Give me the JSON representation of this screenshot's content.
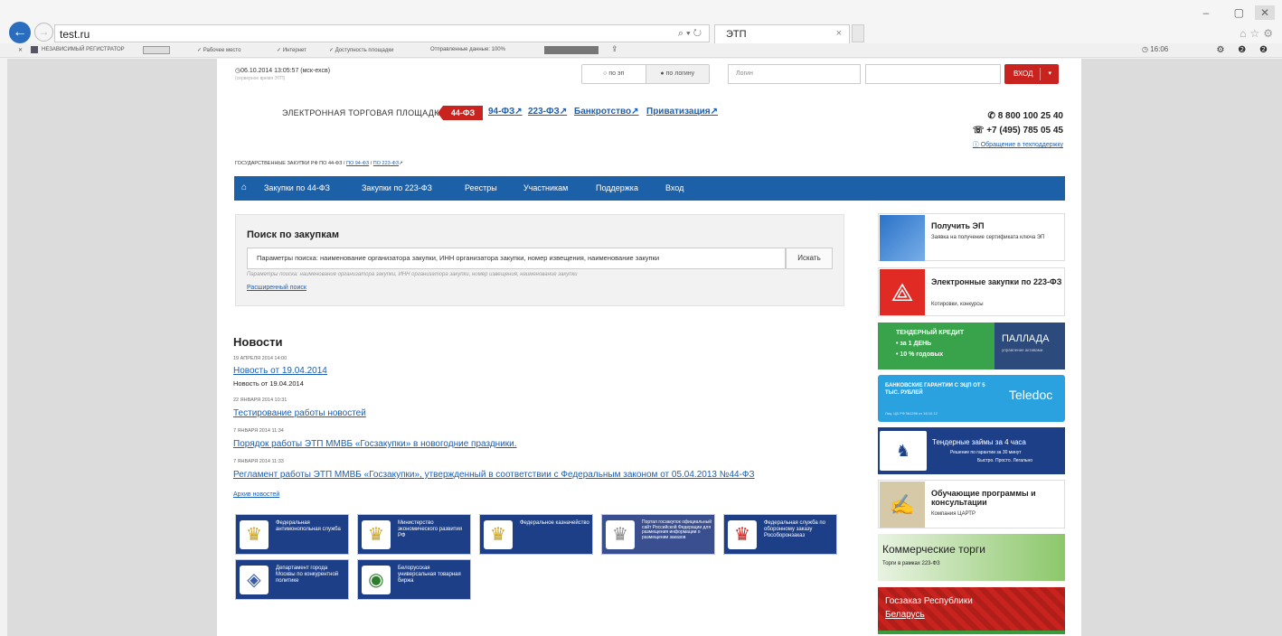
{
  "browser": {
    "url": "test.ru",
    "url_tools": "⌕ ▾ ↻",
    "tab_title": "ЭТП",
    "tab_close": "×",
    "win_controls": "– ▢",
    "win_close": "✕",
    "right_icons": "⌂☆⚙"
  },
  "toolbar": {
    "icon_x": "✕",
    "registrar": "НЕЗАВИСИМЫЙ РЕГИСТРАТОР",
    "workspace": "✓ Рабочее место",
    "internet": "✓ Интернет",
    "availability": "✓ Доступность площадки",
    "sent_data": "Отправленные данные: 100%",
    "clock": "16:06",
    "right_icons": "⚙ ❷ ❷"
  },
  "header": {
    "datetime": "06.10.2014 13:05:57 (мск-ехсв)",
    "server_note": "(серверное время ЭТП)",
    "mode_options": [
      "по эп",
      "по логину"
    ],
    "login_placeholder": "Логин",
    "password_placeholder": "",
    "login_button": "ВХОД",
    "login_caret": "▾"
  },
  "brand": {
    "title": "ЭЛЕКТРОННАЯ ТОРГОВАЯ ПЛОЩАДКА",
    "badge": "44-ФЗ",
    "links": [
      "94-ФЗ",
      "223-ФЗ",
      "Банкротство",
      "Приватизация"
    ],
    "phone1": "8 800 100 25 40",
    "phone2": "+7 (495) 785 05 45",
    "support": "Обращение в техподдержку",
    "gov_prefix": "ГОСУДАРСТВЕННЫЕ ЗАКУПКИ РФ ПО 44-ФЗ /",
    "gov_link1": "ПО 94-ФЗ",
    "gov_link2": "ПО 223-ФЗ"
  },
  "nav": {
    "home_icon": "⌂",
    "items": [
      "Закупки по 44-ФЗ",
      "Закупки по 223-ФЗ",
      "Реестры",
      "Участникам",
      "Поддержка",
      "Вход"
    ]
  },
  "search": {
    "title": "Поиск по закупкам",
    "placeholder": "Параметры поиска: наименование организатора закупки, ИНН организатора закупки, номер извещения, наименование закупки",
    "button": "Искать",
    "hint": "Параметры поиска: наименование организатора закупки, ИНН организатора закупки, номер извещения, наименование закупки",
    "advanced": "Расширенный поиск"
  },
  "news": {
    "heading": "Новости",
    "items": [
      {
        "date": "19 АПРЕЛЯ 2014 14:00",
        "title": "Новость от 19.04.2014",
        "summary": "Новость от 19.04.2014"
      },
      {
        "date": "22 ЯНВАРЯ 2014 10:31",
        "title": "Тестирование работы новостей",
        "summary": ""
      },
      {
        "date": "7 ЯНВАРЯ 2014 11:34",
        "title": "Порядок работы ЭТП ММВБ «Госзакупки» в новогодние праздники.",
        "summary": ""
      },
      {
        "date": "7 ЯНВАРЯ 2014 11:33",
        "title": "Регламент работы ЭТП ММВБ «Госзакупки», утвержденный в соответствии с Федеральным законом от 05.04.2013 №44-ФЗ",
        "summary": ""
      }
    ],
    "archive": "Архив новостей"
  },
  "partners": [
    {
      "name": "Федеральная антимонопольная служба",
      "emblem": "♛"
    },
    {
      "name": "Министерство экономического развития РФ",
      "emblem": "♛"
    },
    {
      "name": "Федеральное казначейство",
      "emblem": "♛"
    },
    {
      "name": "Портал госзакупок официальный сайт Российской Федерации для размещения информации о размещении заказов",
      "emblem": "♛"
    },
    {
      "name": "Федеральная служба по оборонному заказу Рособоронзаказ",
      "emblem": "♛"
    },
    {
      "name": "Департамент города Москвы по конкурентной политике",
      "emblem": "◈"
    },
    {
      "name": "Белорусская универсальная товарная биржа",
      "emblem": "◉"
    }
  ],
  "sidebar": {
    "ep_title": "Получить ЭП",
    "ep_desc": "Заявка на получение сертификата ключа ЭП",
    "z223_title": "Электронные закупки по 223-ФЗ",
    "z223_desc": "Котировки, конкурсы",
    "credit_text": "ТЕНДЕРНЫЙ КРЕДИТ",
    "credit_line1": "• за 1 ДЕНЬ",
    "credit_line2": "• 10 % годовых",
    "credit_brand": "ПАЛЛАДА",
    "credit_sub": "управление активами",
    "teledoc_text": "БАНКОВСКИЕ ГАРАНТИИ С ЭЦП ОТ 5 ТЫС. РУБЛЕЙ",
    "teledoc_brand": "Teledoc",
    "teledoc_fine": "Лиц. ЦБ РФ №1296 от 16.10.12",
    "loan_title": "Тендерные займы за 4 часа",
    "loan_sub1": "Решение по гарантии за 30 минут",
    "loan_sub2": "Быстро. Просто. Легально",
    "edu_title": "Обучающие программы и консультации",
    "edu_desc": "Компания ЦАРТР",
    "comm_title": "Коммерческие торги",
    "comm_desc": "Торги в рамках 223-ФЗ",
    "by_line1": "Госзаказ Республики",
    "by_line2": "Беларусь"
  },
  "colors": {
    "nav_blue": "#1c60a8",
    "brand_red": "#c8231e",
    "link_blue": "#1a5fb4",
    "tile_navy": "#1c3f87"
  }
}
